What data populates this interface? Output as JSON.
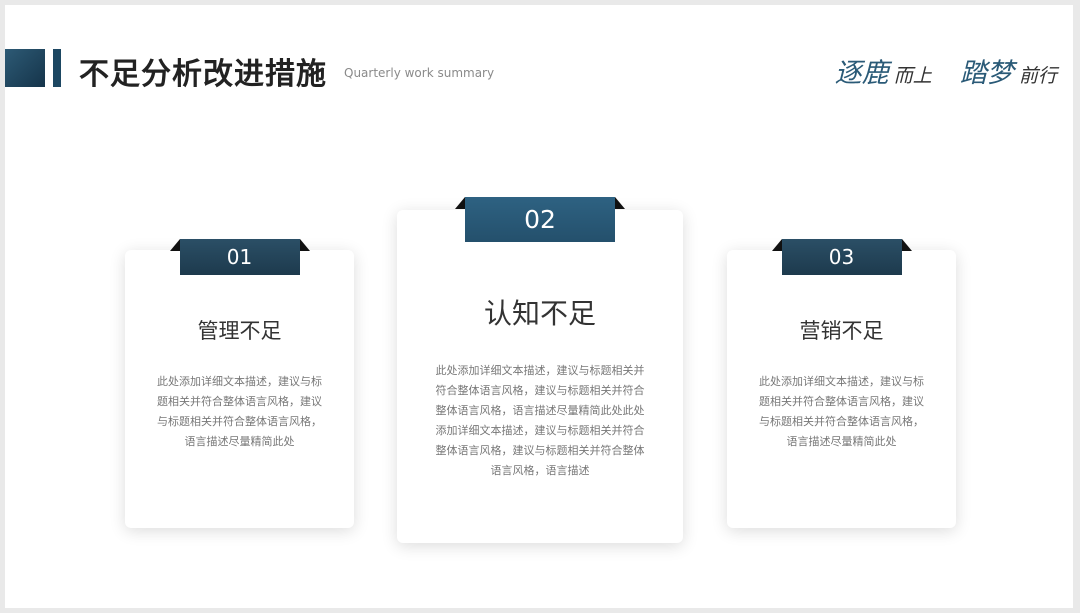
{
  "header": {
    "title": "不足分析改进措施",
    "subtitle": "Quarterly work summary",
    "slogan": {
      "word1": "逐鹿",
      "word2": "而上",
      "word3": "踏梦",
      "word4": "前行"
    }
  },
  "colors": {
    "accent": "#24506c",
    "dark_accent": "#1d3a4d"
  },
  "cards": [
    {
      "number": "01",
      "title": "管理不足",
      "description": "此处添加详细文本描述，建议与标题相关并符合整体语言风格，建议与标题相关并符合整体语言风格，语言描述尽量精简此处"
    },
    {
      "number": "02",
      "title": "认知不足",
      "description": "此处添加详细文本描述，建议与标题相关并符合整体语言风格，建议与标题相关并符合整体语言风格，语言描述尽量精简此处此处添加详细文本描述，建议与标题相关并符合整体语言风格，建议与标题相关并符合整体语言风格，语言描述"
    },
    {
      "number": "03",
      "title": "营销不足",
      "description": "此处添加详细文本描述，建议与标题相关并符合整体语言风格，建议与标题相关并符合整体语言风格，语言描述尽量精简此处"
    }
  ]
}
